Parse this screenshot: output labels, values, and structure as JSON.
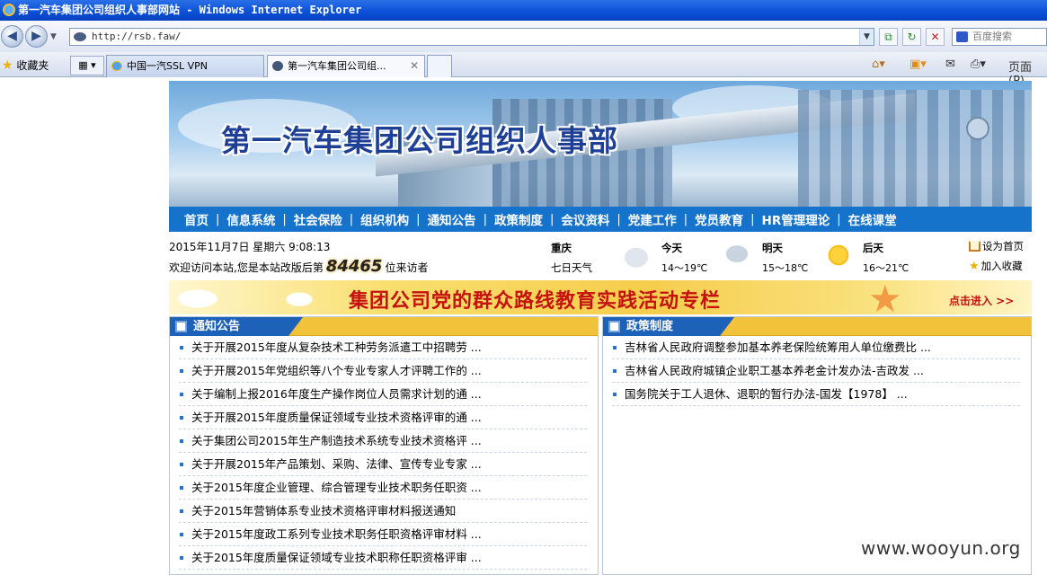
{
  "window": {
    "title": "第一汽车集团公司组织人事部网站 - Windows Internet Explorer"
  },
  "browser": {
    "address": "http://rsb.faw/",
    "search_placeholder": "百度搜索",
    "favorites_label": "收藏夹",
    "tabs": [
      {
        "label": "中国一汽SSL VPN"
      },
      {
        "label": "第一汽车集团公司组..."
      }
    ],
    "page_menu_label": "页面(P)"
  },
  "site": {
    "banner_title": "第一汽车集团公司组织人事部",
    "nav": [
      "首页",
      "信息系统",
      "社会保险",
      "组织机构",
      "通知公告",
      "政策制度",
      "会议资料",
      "党建工作",
      "党员教育",
      "HR管理理论",
      "在线课堂"
    ]
  },
  "info": {
    "datetime": "2015年11月7日  星期六    9:08:13",
    "welcome_prefix": "欢迎访问本站,您是本站改版后第",
    "visitor_count": "84465",
    "welcome_suffix": "位来访者",
    "city": "重庆",
    "week_weather": "七日天气",
    "days": [
      {
        "name": "今天",
        "temp": "14～19℃",
        "icon": "cloud-icon"
      },
      {
        "name": "明天",
        "temp": "15～18℃",
        "icon": "rain-icon"
      },
      {
        "name": "后天",
        "temp": "16～21℃",
        "icon": "sun-icon"
      }
    ],
    "set_home": "设为首页",
    "add_favorite": "加入收藏"
  },
  "promo": {
    "title": "集团公司党的群众路线教育实践活动专栏",
    "enter": "点击进入 >>"
  },
  "notices": {
    "title": "通知公告",
    "items": [
      "关于开展2015年度从复杂技术工种劳务派遣工中招聘劳 ...",
      "关于开展2015年党组织等八个专业专家人才评聘工作的 ...",
      "关于编制上报2016年度生产操作岗位人员需求计划的通 ...",
      "关于开展2015年度质量保证领域专业技术资格评审的通 ...",
      "关于集团公司2015年生产制造技术系统专业技术资格评 ...",
      "关于开展2015年产品策划、采购、法律、宣传专业专家 ...",
      "关于2015年度企业管理、综合管理专业技术职务任职资 ...",
      "关于2015年营销体系专业技术资格评审材料报送通知",
      "关于2015年度政工系列专业技术职务任职资格评审材料 ...",
      "关于2015年度质量保证领域专业技术职称任职资格评审 ..."
    ]
  },
  "policies": {
    "title": "政策制度",
    "items": [
      "吉林省人民政府调整参加基本养老保险统筹用人单位缴费比 ...",
      "吉林省人民政府城镇企业职工基本养老金计发办法-吉政发 ...",
      "国务院关于工人退休、退职的暂行办法-国发【1978】 ..."
    ]
  },
  "watermark": "www.wooyun.org"
}
